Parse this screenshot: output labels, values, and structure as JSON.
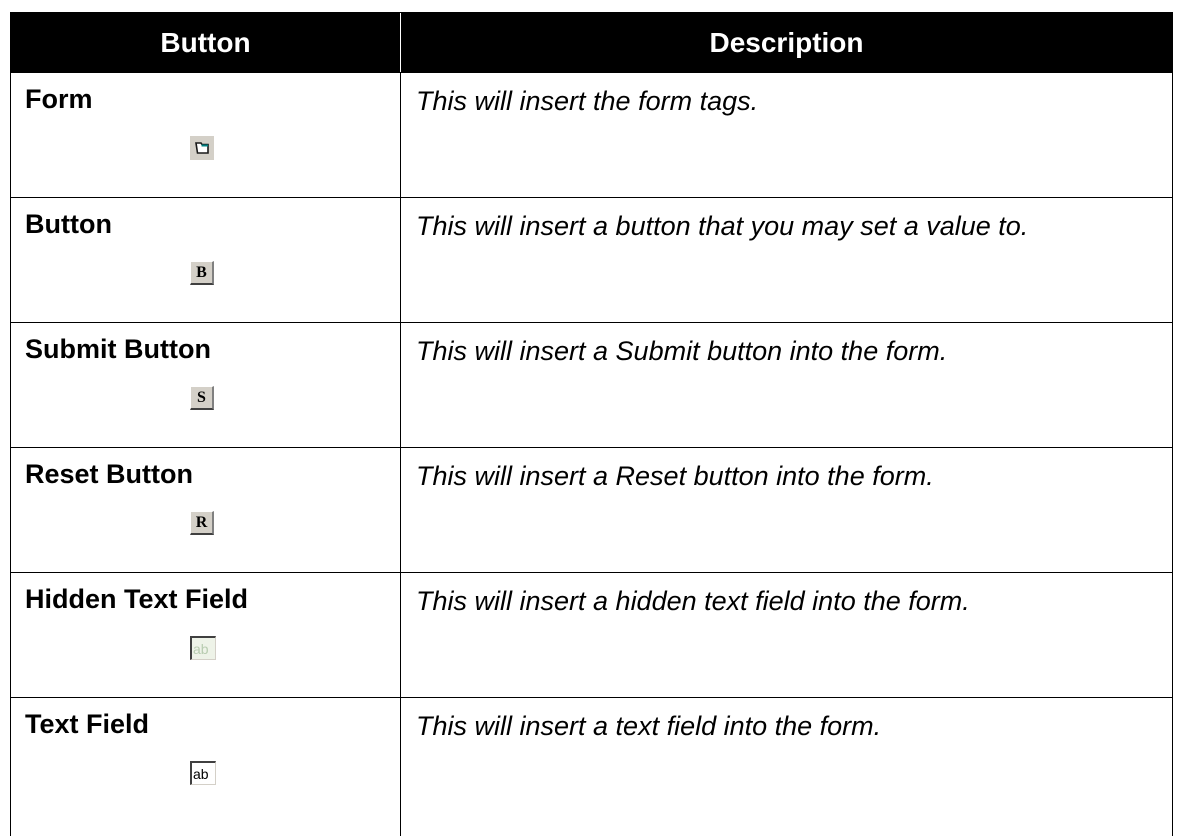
{
  "table": {
    "headers": {
      "button": "Button",
      "description": "Description"
    },
    "rows": [
      {
        "label": "Form",
        "icon": "form-icon",
        "icon_text": "",
        "description": "This will insert the form tags."
      },
      {
        "label": "Button",
        "icon": "button-icon",
        "icon_text": "B",
        "description": "This will insert a button that you may set a value to."
      },
      {
        "label": "Submit Button",
        "icon": "submit-button-icon",
        "icon_text": "S",
        "description": "This will insert a Submit button into the form."
      },
      {
        "label": "Reset Button",
        "icon": "reset-button-icon",
        "icon_text": "R",
        "description": "This will insert a Reset button into the form."
      },
      {
        "label": "Hidden Text Field",
        "icon": "hidden-text-field-icon",
        "icon_text": "ab",
        "description": "This will insert a hidden text field into the form."
      },
      {
        "label": "Text Field",
        "icon": "text-field-icon",
        "icon_text": "ab",
        "description": "This will insert a text field into the form."
      }
    ]
  },
  "colors": {
    "header_background": "#000000",
    "header_text": "#ffffff",
    "icon_face": "#d4d0c8",
    "form_icon_accent": "#008080"
  }
}
